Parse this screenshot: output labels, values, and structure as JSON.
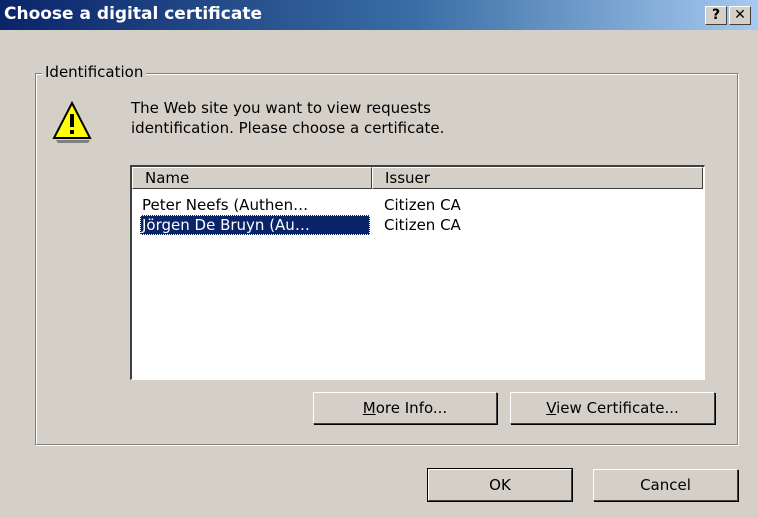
{
  "window": {
    "title": "Choose a digital certificate",
    "help_label": "?",
    "close_label": "✕"
  },
  "group": {
    "label": "Identification"
  },
  "message": {
    "line1": "The Web site you want to view requests",
    "line2": "identification. Please choose a certificate."
  },
  "table": {
    "columns": [
      "Name",
      "Issuer"
    ],
    "rows": [
      {
        "name": "Peter Neefs (Authen…",
        "issuer": "Citizen CA",
        "selected": false
      },
      {
        "name": "Jörgen De Bruyn (Au…",
        "issuer": "Citizen CA",
        "selected": true
      }
    ]
  },
  "buttons": {
    "more_info": {
      "mnemonic": "M",
      "rest": "ore Info..."
    },
    "view_certificate": {
      "mnemonic": "V",
      "rest": "iew Certificate..."
    },
    "ok": "OK",
    "cancel": "Cancel"
  },
  "icons": {
    "warning": "warning-triangle-icon"
  },
  "colors": {
    "title_start": "#0a246a",
    "title_end": "#a6caf0",
    "selection": "#0a246a",
    "face": "#d4d0c8"
  }
}
